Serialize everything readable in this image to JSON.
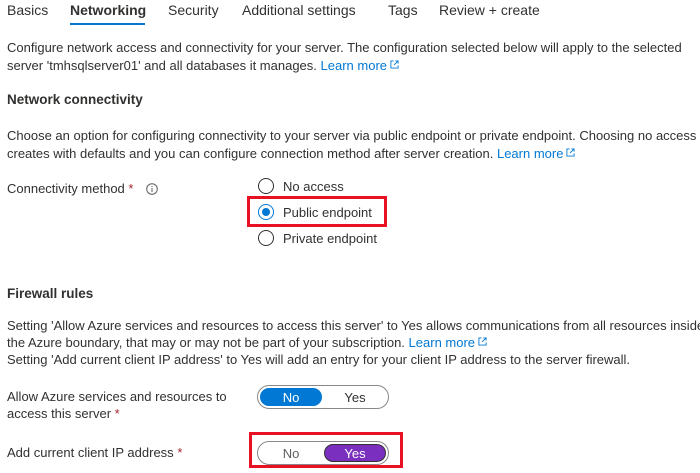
{
  "tabs": [
    {
      "label": "Basics"
    },
    {
      "label": "Networking",
      "active": true
    },
    {
      "label": "Security"
    },
    {
      "label": "Additional settings"
    },
    {
      "label": "Tags"
    },
    {
      "label": "Review + create"
    }
  ],
  "intro": {
    "line1": "Configure network access and connectivity for your server. The configuration selected below will apply to the selected",
    "line2": "server 'tmhsqlserver01' and all databases it manages.",
    "learn_more": "Learn more"
  },
  "network_connectivity": {
    "heading": "Network connectivity",
    "desc_line1": "Choose an option for configuring connectivity to your server via public endpoint or private endpoint. Choosing no access",
    "desc_line2": "creates with defaults and you can configure connection method after server creation.",
    "learn_more": "Learn more",
    "method_label": "Connectivity method",
    "required_mark": "*",
    "options": [
      {
        "label": "No access",
        "selected": false
      },
      {
        "label": "Public endpoint",
        "selected": true
      },
      {
        "label": "Private endpoint",
        "selected": false
      }
    ]
  },
  "firewall": {
    "heading": "Firewall rules",
    "desc_line1": "Setting 'Allow Azure services and resources to access this server' to Yes allows communications from all resources inside",
    "desc_line2": "the Azure boundary, that may or may not be part of your subscription.",
    "learn_more": "Learn more",
    "desc_line3": "Setting 'Add current client IP address' to Yes will add an entry for your client IP address to the server firewall.",
    "allow_azure": {
      "label_line1": "Allow Azure services and resources to",
      "label_line2": "access this server",
      "required_mark": "*",
      "no": "No",
      "yes": "Yes",
      "value": "No"
    },
    "client_ip": {
      "label": "Add current client IP address",
      "required_mark": "*",
      "no": "No",
      "yes": "Yes",
      "value": "Yes"
    }
  },
  "colors": {
    "accent": "#0078d4",
    "highlight": "#e81123",
    "toggle_yes": "#7b2fbf",
    "required": "#a4262c"
  }
}
